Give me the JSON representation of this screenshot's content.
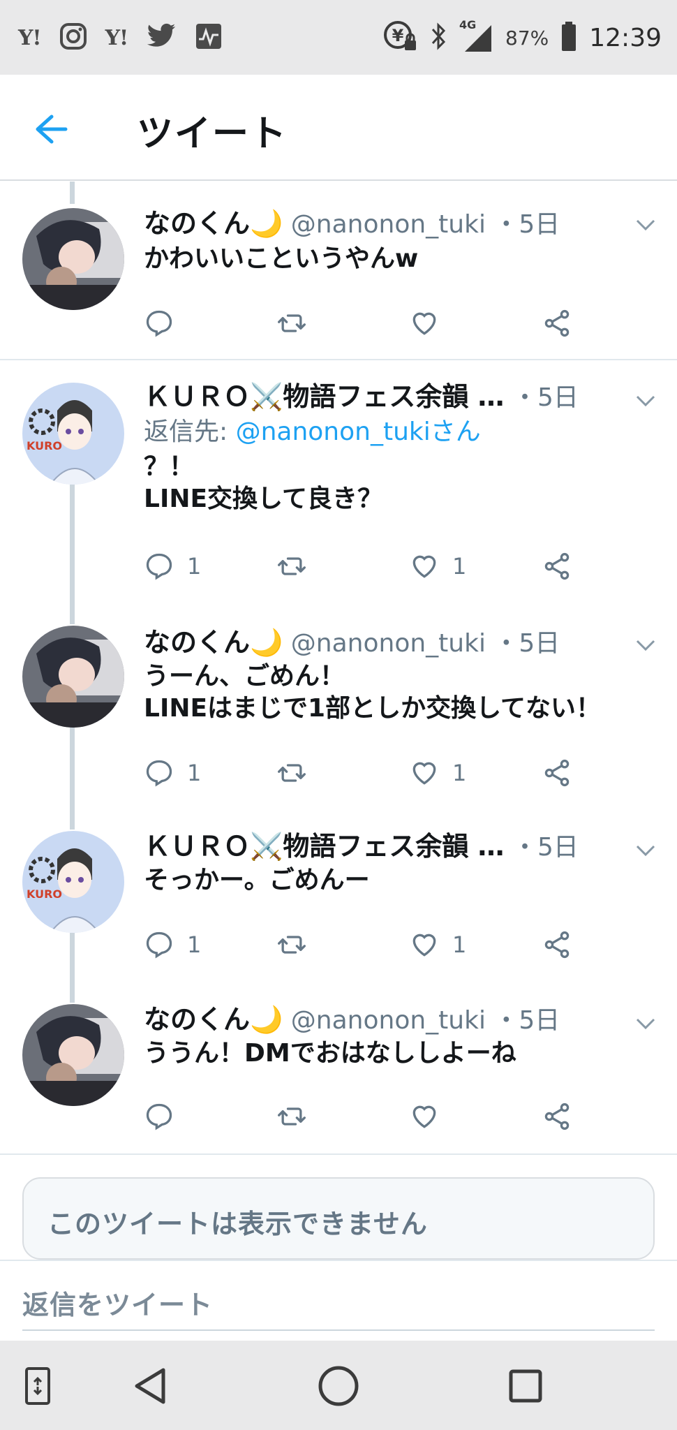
{
  "status_bar": {
    "left_icons": [
      "yahoo-icon",
      "instagram-icon",
      "yahoo-icon",
      "twitter-icon",
      "activity-icon"
    ],
    "yahoo_label": "Y!",
    "network": "4G",
    "battery": "87%",
    "time": "12:39"
  },
  "header": {
    "title": "ツイート"
  },
  "tweets": [
    {
      "name": "なのくん🌙",
      "handle": "@nanonon_tuki",
      "time": "・5日",
      "reply_prefix": "",
      "reply_mention": "",
      "body": "かわいいこというやんw",
      "replies": "",
      "likes": ""
    },
    {
      "name": "ＫＵＲＯ⚔️物語フェス余韻 …",
      "handle": "",
      "time": "・5日",
      "reply_prefix": "返信先: ",
      "reply_mention": "@nanonon_tukiさん",
      "body": "？！\nLINE交換して良き？",
      "replies": "1",
      "likes": "1"
    },
    {
      "name": "なのくん🌙",
      "handle": "@nanonon_tuki",
      "time": "・5日",
      "reply_prefix": "",
      "reply_mention": "",
      "body": "うーん、ごめん！\nLINEはまじで1部としか交換してない！",
      "replies": "1",
      "likes": "1"
    },
    {
      "name": "ＫＵＲＯ⚔️物語フェス余韻 …",
      "handle": "",
      "time": "・5日",
      "reply_prefix": "",
      "reply_mention": "",
      "body": "そっかー。ごめんー",
      "replies": "1",
      "likes": "1"
    },
    {
      "name": "なのくん🌙",
      "handle": "@nanonon_tuki",
      "time": "・5日",
      "reply_prefix": "",
      "reply_mention": "",
      "body": "ううん！DMでおはなししよーね",
      "replies": "",
      "likes": ""
    }
  ],
  "unavailable_notice": "このツイートは表示できません",
  "reply_placeholder": "返信をツイート",
  "colors": {
    "accent": "#1da1f2",
    "secondary_text": "#657786",
    "thread_line": "#ccd6dd"
  }
}
